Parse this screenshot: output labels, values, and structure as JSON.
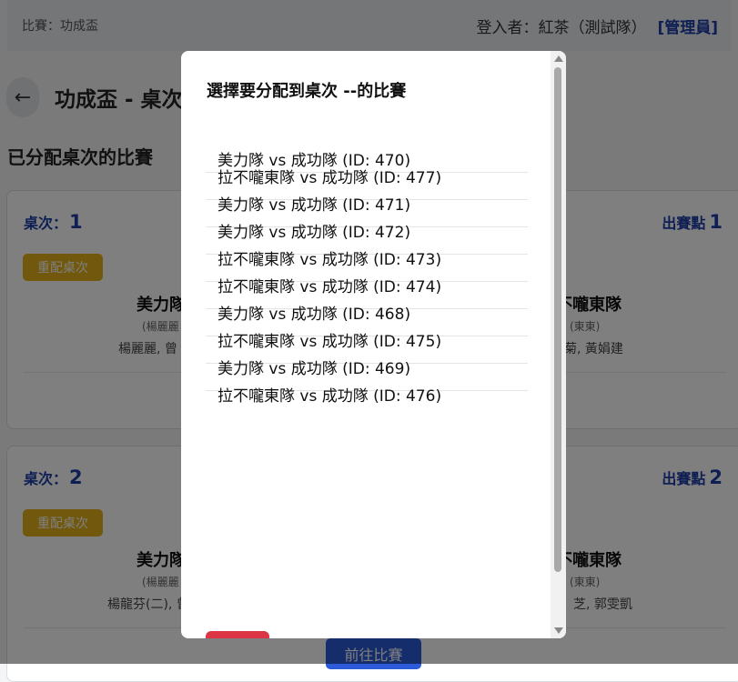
{
  "topbar": {
    "competition": "比賽：功成盃",
    "logged_in": "登入者：紅茶（測試隊）",
    "admin_link": "[管理員]"
  },
  "page": {
    "back_icon": "←",
    "title": "功成盃 - 桌次",
    "section_title": "已分配桌次的比賽"
  },
  "cards": [
    {
      "table_label": "桌次：",
      "table_no": "1",
      "serve_label": "出賽點",
      "serve_no": "1",
      "reassign_label": "重配桌次",
      "left_team": "美力隊",
      "left_coach": "(楊麗麗",
      "left_players": "楊麗麗, 曾",
      "right_team": "拉不嚨東隊",
      "right_coach": "(東東)",
      "right_players": "菊, 黃娟建"
    },
    {
      "table_label": "桌次：",
      "table_no": "2",
      "serve_label": "出賽點",
      "serve_no": "2",
      "reassign_label": "重配桌次",
      "left_team": "美力隊",
      "left_coach": "(楊麗麗",
      "left_players": "楊龍芬(二), 曾",
      "right_team": "拉不嚨東隊",
      "right_coach": "(東東)",
      "right_players": "芝, 郭雯凱"
    }
  ],
  "goto_button": "前往比賽",
  "modal": {
    "title": "選擇要分配到桌次 --的比賽",
    "matches": [
      "美力隊 vs 成功隊 (ID: 470)",
      "拉不嚨東隊 vs 成功隊 (ID: 477)",
      "美力隊 vs 成功隊 (ID: 471)",
      "美力隊 vs 成功隊 (ID: 472)",
      "拉不嚨東隊 vs 成功隊 (ID: 473)",
      "拉不嚨東隊 vs 成功隊 (ID: 474)",
      "美力隊 vs 成功隊 (ID: 468)",
      "拉不嚨東隊 vs 成功隊 (ID: 475)",
      "美力隊 vs 成功隊 (ID: 469)",
      "拉不嚨東隊 vs 成功隊 (ID: 476)"
    ]
  },
  "colors": {
    "accent": "#1f3ea8",
    "reassign": "#e3b118",
    "primary_button": "#2d5bd9",
    "danger": "#dc3545"
  }
}
